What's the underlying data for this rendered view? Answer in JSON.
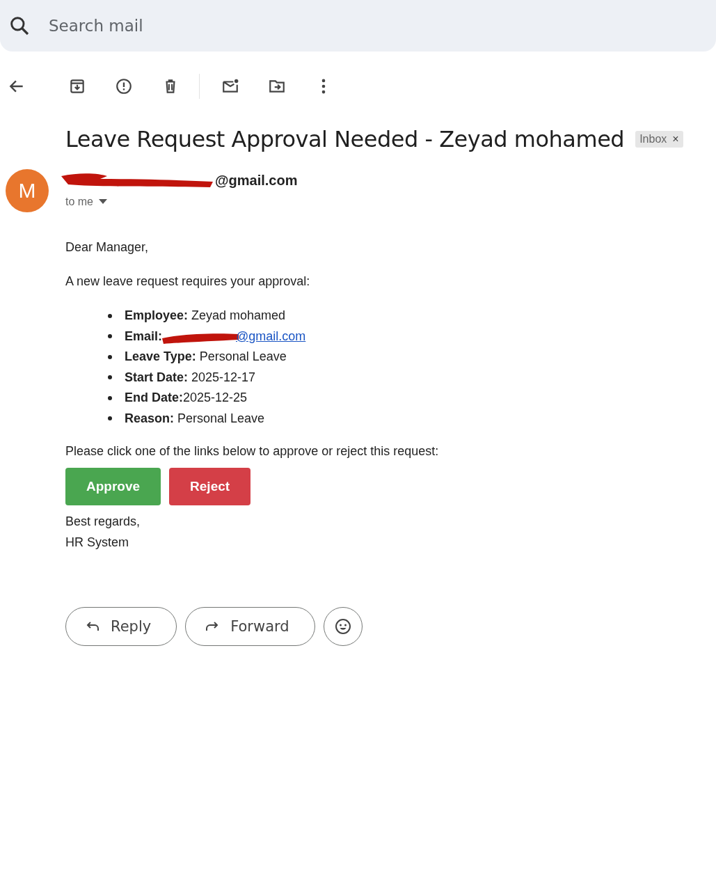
{
  "search": {
    "placeholder": "Search mail"
  },
  "toolbar": {
    "actions": [
      {
        "kind": "back"
      },
      {
        "kind": "archive"
      },
      {
        "kind": "spam"
      },
      {
        "kind": "delete"
      },
      {
        "kind": "divider"
      },
      {
        "kind": "unread"
      },
      {
        "kind": "move"
      },
      {
        "kind": "more"
      }
    ]
  },
  "message": {
    "subject": "Leave Request Approval Needed - Zeyad mohamed",
    "label": {
      "text": "Inbox",
      "close": "×"
    },
    "sender": {
      "avatar": "M",
      "redacted": true,
      "address_visible": "@gmail.com",
      "recipient": "to me"
    },
    "greeting": "Dear Manager,",
    "intro": "A new leave request requires your approval:",
    "details": [
      {
        "kind": "text",
        "label": "Employee:",
        "value": " Zeyad mohamed"
      },
      {
        "kind": "link",
        "label": "Email:",
        "redacted": true,
        "value": "@gmail.com"
      },
      {
        "kind": "text",
        "label": "Leave Type:",
        "value": " Personal Leave"
      },
      {
        "kind": "text",
        "label": "Start Date:",
        "value": " 2025-12-17"
      },
      {
        "kind": "text",
        "label": "End Date:",
        "value": "2025-12-25"
      },
      {
        "kind": "text",
        "label": "Reason:",
        "value": " Personal Leave"
      }
    ],
    "prompt": "Please click one of the links below to approve or reject this request:",
    "actions": [
      {
        "text": "Approve",
        "color": "#4aa650"
      },
      {
        "text": "Reject",
        "color": "#d43f47"
      }
    ],
    "signoff": [
      "Best regards,",
      "HR System"
    ]
  },
  "replies": [
    {
      "kind": "reply",
      "text": "Reply"
    },
    {
      "kind": "forward",
      "text": "Forward"
    },
    {
      "kind": "emoji"
    }
  ]
}
